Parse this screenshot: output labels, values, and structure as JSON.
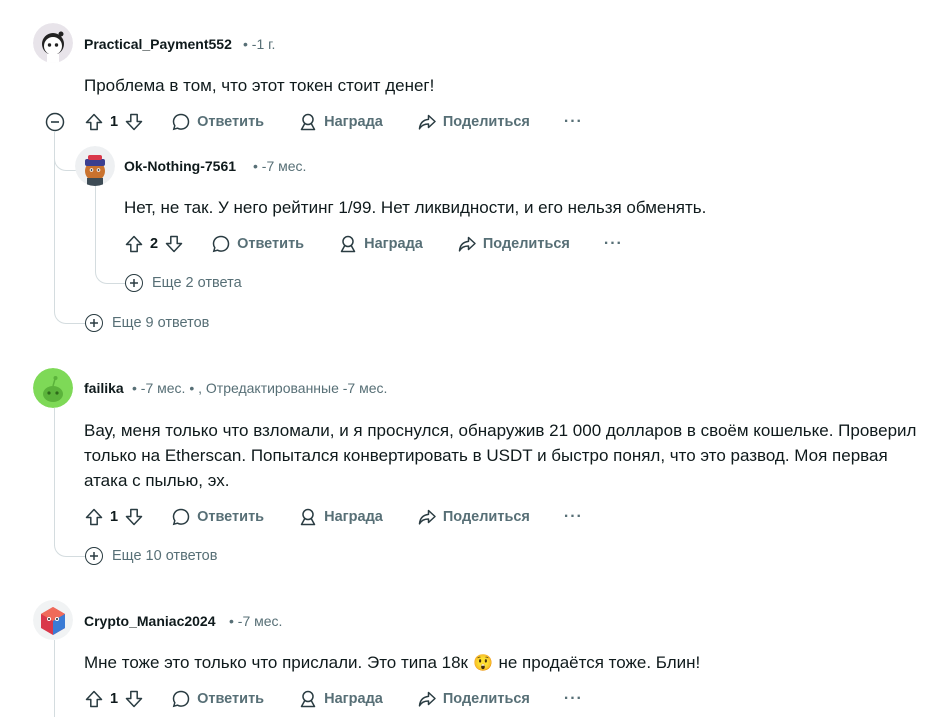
{
  "comments": [
    {
      "author": "Practical_Payment552",
      "meta": "• -1 г.",
      "body": "Проблема в том, что этот токен стоит денег!",
      "votes": "1",
      "more_replies": "Еще 9 ответов"
    },
    {
      "author": "Ok-Nothing-7561",
      "meta": "• -7 мес.",
      "body": "Нет, не так. У него рейтинг 1/99. Нет ликвидности, и его нельзя обменять.",
      "votes": "2",
      "more_replies": "Еще 2 ответа"
    },
    {
      "author": "failika",
      "meta": "• -7 мес. • , Отредактированные -7 мес.",
      "body_lines": [
        "Вау, меня только что взломали, и я проснулся, обнаружив 21 000 долларов в своём кошельке. Проверил",
        "только на Etherscan. Попытался конвертировать в USDT и быстро понял, что это развод. Моя первая",
        "атака с пылью, эх."
      ],
      "votes": "1",
      "more_replies": "Еще 10 ответов"
    },
    {
      "author": "Crypto_Maniac2024",
      "meta": "• -7 мес.",
      "body_before": "Мне тоже это только что прислали. Это типа 18к",
      "body_emoji": "😲",
      "body_after": "не продаётся тоже. Блин!",
      "votes": "1"
    }
  ],
  "actions": {
    "reply": "Ответить",
    "award": "Награда",
    "share": "Поделиться",
    "more": "···"
  },
  "icons": [
    "upvote-icon",
    "downvote-icon",
    "comment-icon",
    "award-icon",
    "share-icon",
    "collapse-icon",
    "expand-icon"
  ],
  "colors": {
    "text": "#0f1a1c",
    "muted": "#576f76",
    "thread": "#d4dcdf",
    "background": "#ffffff"
  }
}
